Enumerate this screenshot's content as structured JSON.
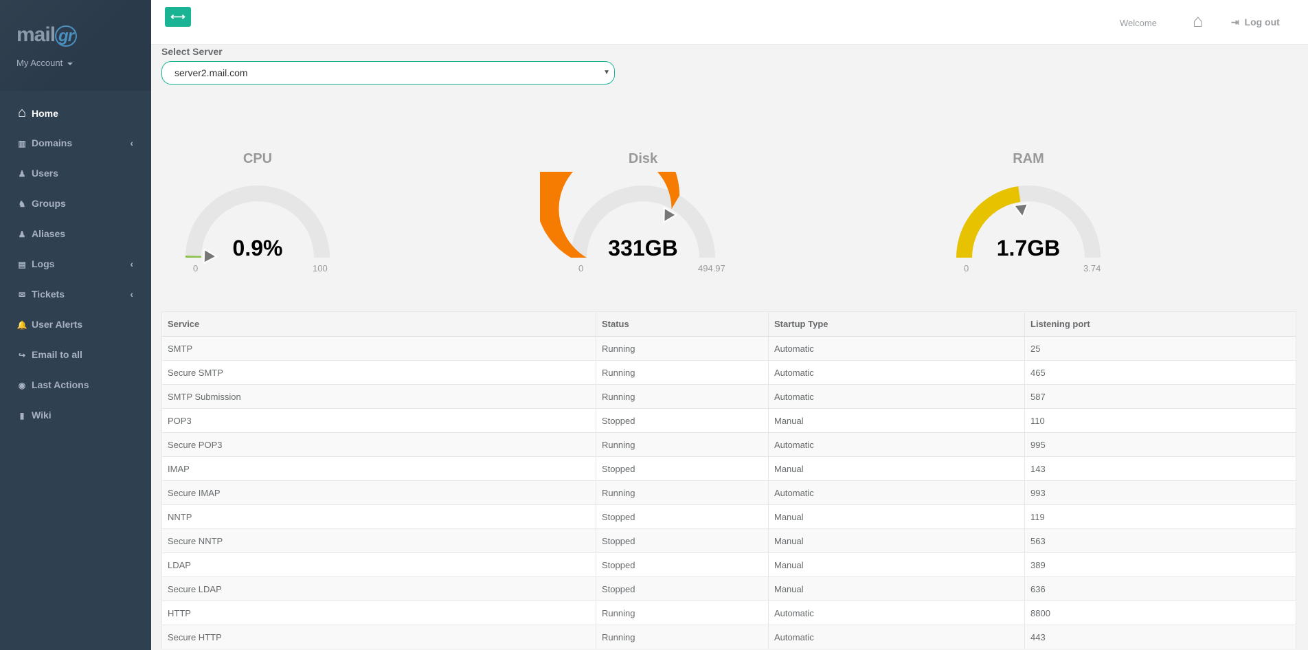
{
  "sidebar": {
    "logo_text": "mail",
    "logo_accent": "gr",
    "account_label": "My Account",
    "items": [
      {
        "label": "Home",
        "icon": "home-icon",
        "has_arrow": false
      },
      {
        "label": "Domains",
        "icon": "bar-chart-icon",
        "has_arrow": true
      },
      {
        "label": "Users",
        "icon": "user-icon",
        "has_arrow": false
      },
      {
        "label": "Groups",
        "icon": "users-icon",
        "has_arrow": false
      },
      {
        "label": "Aliases",
        "icon": "user-icon",
        "has_arrow": false
      },
      {
        "label": "Logs",
        "icon": "file-icon",
        "has_arrow": true
      },
      {
        "label": "Tickets",
        "icon": "envelope-icon",
        "has_arrow": true
      },
      {
        "label": "User Alerts",
        "icon": "bell-icon",
        "has_arrow": false
      },
      {
        "label": "Email to all",
        "icon": "share-icon",
        "has_arrow": false
      },
      {
        "label": "Last Actions",
        "icon": "eye-icon",
        "has_arrow": false
      },
      {
        "label": "Wiki",
        "icon": "book-icon",
        "has_arrow": false
      }
    ]
  },
  "topbar": {
    "toggle_label": "⟷",
    "welcome": "Welcome",
    "logout": "Log out"
  },
  "server": {
    "label": "Select Server",
    "selected": "server2.mail.com"
  },
  "gauges": [
    {
      "title": "CPU",
      "value_text": "0.9%",
      "min": "0",
      "max": "100",
      "fraction": 0.009,
      "color": "#8bc34a"
    },
    {
      "title": "Disk",
      "value_text": "331GB",
      "min": "0",
      "max": "494.97",
      "fraction": 0.669,
      "color": "#f57c00"
    },
    {
      "title": "RAM",
      "value_text": "1.7GB",
      "min": "0",
      "max": "3.74",
      "fraction": 0.455,
      "color": "#e6c200"
    }
  ],
  "table": {
    "headers": [
      "Service",
      "Status",
      "Startup Type",
      "Listening port"
    ],
    "rows": [
      {
        "service": "SMTP",
        "status": "Running",
        "startup": "Automatic",
        "port": "25"
      },
      {
        "service": "Secure SMTP",
        "status": "Running",
        "startup": "Automatic",
        "port": "465"
      },
      {
        "service": "SMTP Submission",
        "status": "Running",
        "startup": "Automatic",
        "port": "587"
      },
      {
        "service": "POP3",
        "status": "Stopped",
        "startup": "Manual",
        "port": "110"
      },
      {
        "service": "Secure POP3",
        "status": "Running",
        "startup": "Automatic",
        "port": "995"
      },
      {
        "service": "IMAP",
        "status": "Stopped",
        "startup": "Manual",
        "port": "143"
      },
      {
        "service": "Secure IMAP",
        "status": "Running",
        "startup": "Automatic",
        "port": "993"
      },
      {
        "service": "NNTP",
        "status": "Stopped",
        "startup": "Manual",
        "port": "119"
      },
      {
        "service": "Secure NNTP",
        "status": "Stopped",
        "startup": "Manual",
        "port": "563"
      },
      {
        "service": "LDAP",
        "status": "Stopped",
        "startup": "Manual",
        "port": "389"
      },
      {
        "service": "Secure LDAP",
        "status": "Stopped",
        "startup": "Manual",
        "port": "636"
      },
      {
        "service": "HTTP",
        "status": "Running",
        "startup": "Automatic",
        "port": "8800"
      },
      {
        "service": "Secure HTTP",
        "status": "Running",
        "startup": "Automatic",
        "port": "443"
      }
    ]
  }
}
